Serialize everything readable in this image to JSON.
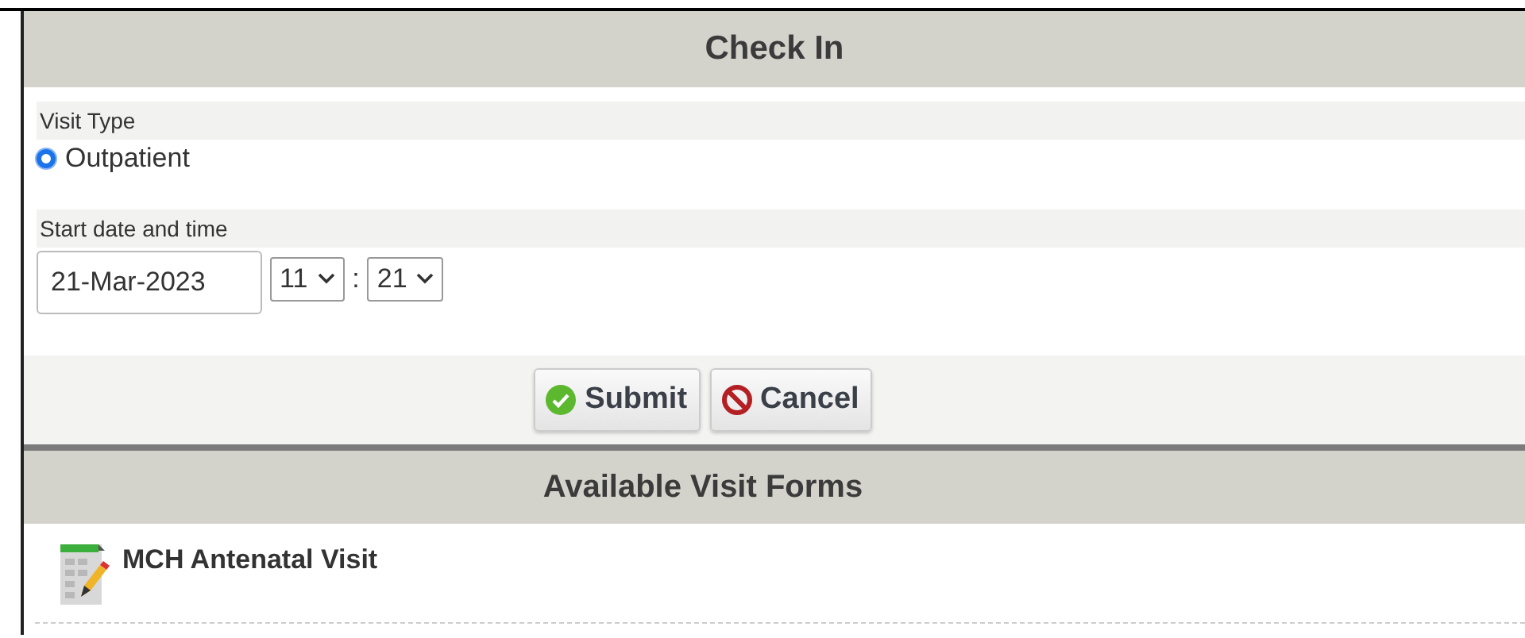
{
  "check_in": {
    "title": "Check In",
    "visit_type": {
      "label": "Visit Type",
      "options": [
        {
          "label": "Outpatient",
          "selected": true
        }
      ]
    },
    "start": {
      "label": "Start date and time",
      "date": "21-Mar-2023",
      "hour": "11",
      "separator": ":",
      "minute": "21"
    },
    "buttons": [
      {
        "kind": "submit",
        "label": "Submit"
      },
      {
        "kind": "cancel",
        "label": "Cancel"
      }
    ]
  },
  "visit_forms": {
    "title": "Available Visit Forms",
    "items": [
      {
        "label": "MCH Antenatal Visit"
      }
    ]
  }
}
